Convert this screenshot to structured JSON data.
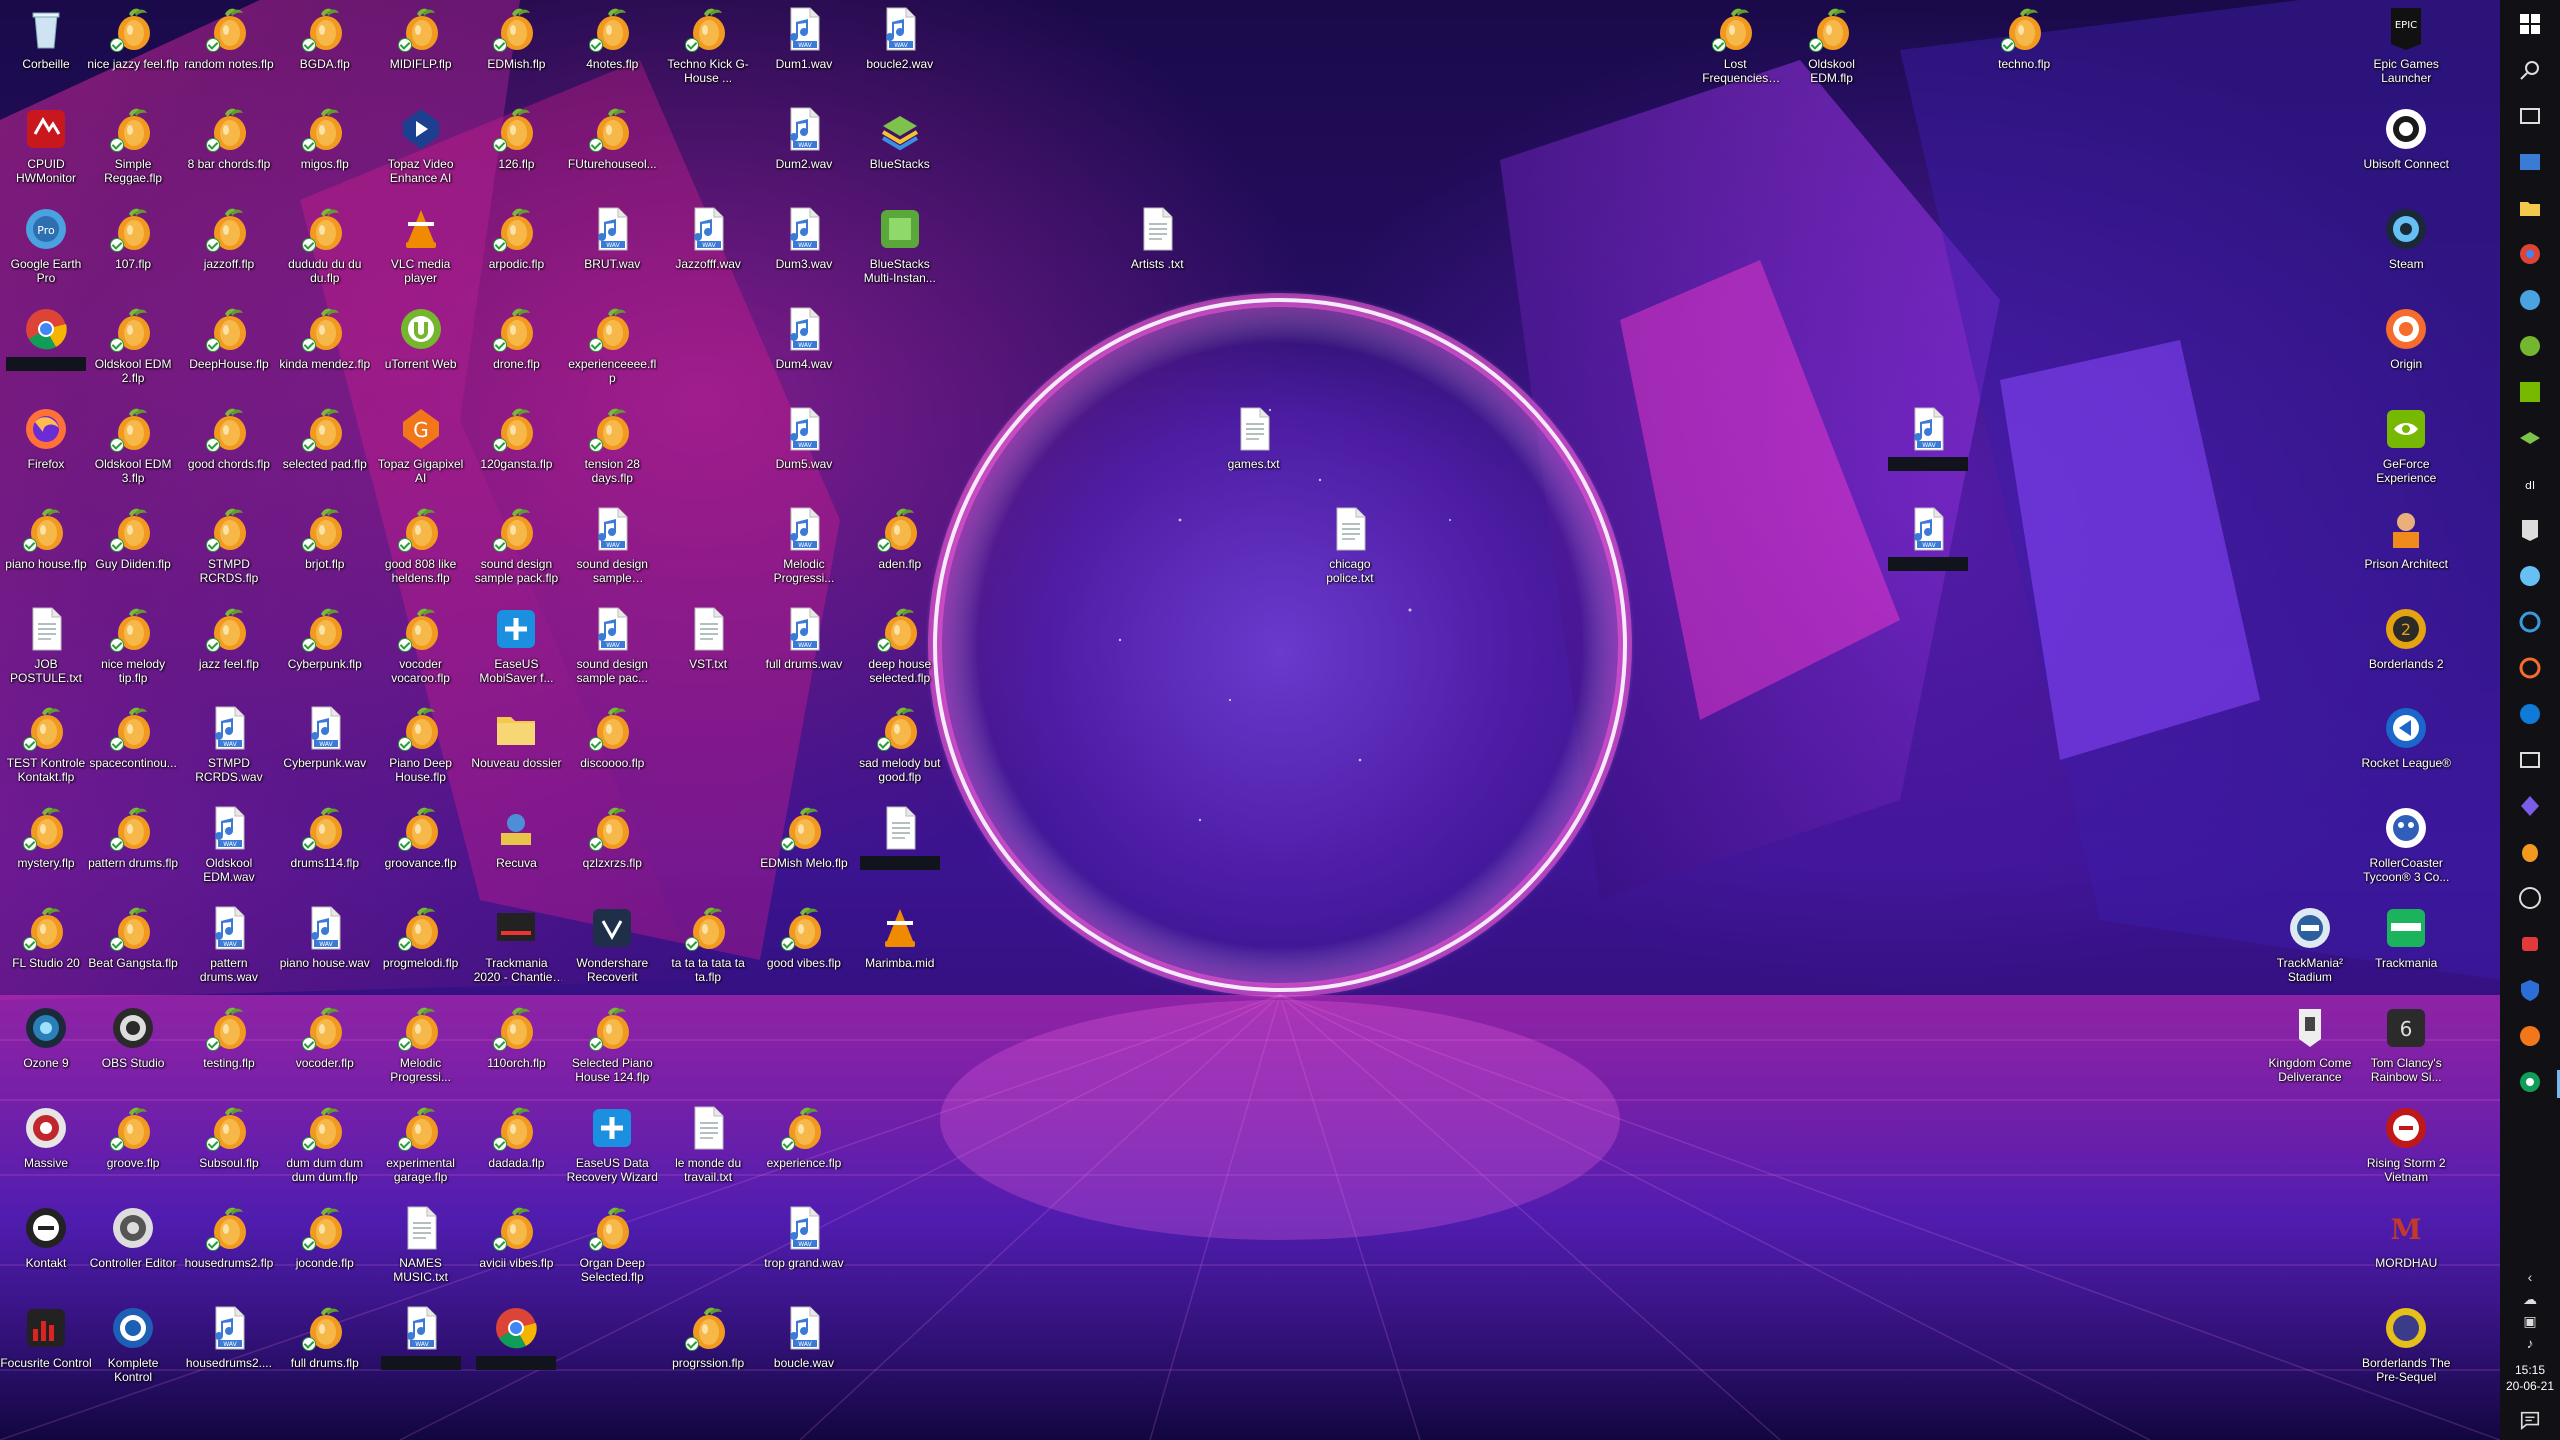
{
  "screen": {
    "width": 2560,
    "height": 1440
  },
  "accent_colors": {
    "fl_orange": "#f29a1f",
    "wav_blue": "#3b7bd6",
    "ring_glow": "#e8d8ff",
    "taskbar": "#101015"
  },
  "desktop_icons": [
    {
      "label": "Corbeille",
      "icon": "recycle-bin",
      "col": 0,
      "row": 0
    },
    {
      "label": "CPUID HWMonitor",
      "icon": "hwmonitor",
      "col": 0,
      "row": 1
    },
    {
      "label": "Google Earth Pro",
      "icon": "google-earth",
      "col": 0,
      "row": 2
    },
    {
      "label": "",
      "icon": "chrome",
      "col": 0,
      "row": 3,
      "redacted": true
    },
    {
      "label": "Firefox",
      "icon": "firefox",
      "col": 0,
      "row": 4
    },
    {
      "label": "piano house.flp",
      "icon": "fl-project",
      "col": 0,
      "row": 5
    },
    {
      "label": "JOB POSTULE.txt",
      "icon": "text-file",
      "col": 0,
      "row": 6
    },
    {
      "label": "TEST Kontrole Kontakt.flp",
      "icon": "fl-project",
      "col": 0,
      "row": 7
    },
    {
      "label": "mystery.flp",
      "icon": "fl-project",
      "col": 0,
      "row": 8
    },
    {
      "label": "FL Studio 20",
      "icon": "fl-project",
      "col": 0,
      "row": 9
    },
    {
      "label": "Ozone 9",
      "icon": "ozone",
      "col": 0,
      "row": 10
    },
    {
      "label": "Massive",
      "icon": "massive",
      "col": 0,
      "row": 11
    },
    {
      "label": "Kontakt",
      "icon": "kontakt",
      "col": 0,
      "row": 12
    },
    {
      "label": "Focusrite Control",
      "icon": "focusrite",
      "col": 0,
      "row": 13
    },
    {
      "label": "nice jazzy feel.flp",
      "icon": "fl-project",
      "col": 1,
      "row": 0
    },
    {
      "label": "Simple Reggae.flp",
      "icon": "fl-project",
      "col": 1,
      "row": 1
    },
    {
      "label": "107.flp",
      "icon": "fl-project",
      "col": 1,
      "row": 2
    },
    {
      "label": "Oldskool EDM 2.flp",
      "icon": "fl-project",
      "col": 1,
      "row": 3
    },
    {
      "label": "Oldskool EDM 3.flp",
      "icon": "fl-project",
      "col": 1,
      "row": 4
    },
    {
      "label": "Guy Diiden.flp",
      "icon": "fl-project",
      "col": 1,
      "row": 5
    },
    {
      "label": "nice melody tip.flp",
      "icon": "fl-project",
      "col": 1,
      "row": 6
    },
    {
      "label": "spacecontinou...",
      "icon": "fl-project",
      "col": 1,
      "row": 7
    },
    {
      "label": "pattern drums.flp",
      "icon": "fl-project",
      "col": 1,
      "row": 8
    },
    {
      "label": "Beat Gangsta.flp",
      "icon": "fl-project",
      "col": 1,
      "row": 9
    },
    {
      "label": "OBS Studio",
      "icon": "obs",
      "col": 1,
      "row": 10
    },
    {
      "label": "groove.flp",
      "icon": "fl-project",
      "col": 1,
      "row": 11
    },
    {
      "label": "Controller Editor",
      "icon": "controller-editor",
      "col": 1,
      "row": 12
    },
    {
      "label": "Komplete Kontrol",
      "icon": "komplete",
      "col": 1,
      "row": 13
    },
    {
      "label": "random notes.flp",
      "icon": "fl-project",
      "col": 2,
      "row": 0
    },
    {
      "label": "8 bar chords.flp",
      "icon": "fl-project",
      "col": 2,
      "row": 1
    },
    {
      "label": "jazzoff.flp",
      "icon": "fl-project",
      "col": 2,
      "row": 2
    },
    {
      "label": "DeepHouse.flp",
      "icon": "fl-project",
      "col": 2,
      "row": 3
    },
    {
      "label": "good chords.flp",
      "icon": "fl-project",
      "col": 2,
      "row": 4
    },
    {
      "label": "STMPD RCRDS.flp",
      "icon": "fl-project",
      "col": 2,
      "row": 5
    },
    {
      "label": "jazz feel.flp",
      "icon": "fl-project",
      "col": 2,
      "row": 6
    },
    {
      "label": "STMPD RCRDS.wav",
      "icon": "wav-file",
      "col": 2,
      "row": 7
    },
    {
      "label": "Oldskool EDM.wav",
      "icon": "wav-file",
      "col": 2,
      "row": 8
    },
    {
      "label": "pattern drums.wav",
      "icon": "wav-file",
      "col": 2,
      "row": 9
    },
    {
      "label": "testing.flp",
      "icon": "fl-project",
      "col": 2,
      "row": 10
    },
    {
      "label": "Subsoul.flp",
      "icon": "fl-project",
      "col": 2,
      "row": 11
    },
    {
      "label": "housedrums2.flp",
      "icon": "fl-project",
      "col": 2,
      "row": 12
    },
    {
      "label": "housedrums2....",
      "icon": "wav-file",
      "col": 2,
      "row": 13
    },
    {
      "label": "BGDA.flp",
      "icon": "fl-project",
      "col": 3,
      "row": 0
    },
    {
      "label": "migos.flp",
      "icon": "fl-project",
      "col": 3,
      "row": 1
    },
    {
      "label": "dududu du du du.flp",
      "icon": "fl-project",
      "col": 3,
      "row": 2
    },
    {
      "label": "kinda mendez.flp",
      "icon": "fl-project",
      "col": 3,
      "row": 3
    },
    {
      "label": "selected pad.flp",
      "icon": "fl-project",
      "col": 3,
      "row": 4
    },
    {
      "label": "brjot.flp",
      "icon": "fl-project",
      "col": 3,
      "row": 5
    },
    {
      "label": "Cyberpunk.flp",
      "icon": "fl-project",
      "col": 3,
      "row": 6
    },
    {
      "label": "Cyberpunk.wav",
      "icon": "wav-file",
      "col": 3,
      "row": 7
    },
    {
      "label": "drums114.flp",
      "icon": "fl-project",
      "col": 3,
      "row": 8
    },
    {
      "label": "piano house.wav",
      "icon": "wav-file",
      "col": 3,
      "row": 9
    },
    {
      "label": "vocoder.flp",
      "icon": "fl-project",
      "col": 3,
      "row": 10
    },
    {
      "label": "dum dum dum dum dum.flp",
      "icon": "fl-project",
      "col": 3,
      "row": 11
    },
    {
      "label": "joconde.flp",
      "icon": "fl-project",
      "col": 3,
      "row": 12
    },
    {
      "label": "full drums.flp",
      "icon": "fl-project",
      "col": 3,
      "row": 13
    },
    {
      "label": "MIDIFLP.flp",
      "icon": "fl-project",
      "col": 4,
      "row": 0
    },
    {
      "label": "Topaz Video Enhance AI",
      "icon": "topaz-video",
      "col": 4,
      "row": 1
    },
    {
      "label": "VLC media player",
      "icon": "vlc",
      "col": 4,
      "row": 2
    },
    {
      "label": "uTorrent Web",
      "icon": "utorrent",
      "col": 4,
      "row": 3
    },
    {
      "label": "Topaz Gigapixel AI",
      "icon": "topaz-giga",
      "col": 4,
      "row": 4
    },
    {
      "label": "good 808 like heldens.flp",
      "icon": "fl-project",
      "col": 4,
      "row": 5
    },
    {
      "label": "vocoder vocaroo.flp",
      "icon": "fl-project",
      "col": 4,
      "row": 6
    },
    {
      "label": "Piano Deep House.flp",
      "icon": "fl-project",
      "col": 4,
      "row": 7
    },
    {
      "label": "groovance.flp",
      "icon": "fl-project",
      "col": 4,
      "row": 8
    },
    {
      "label": "progmelodi.flp",
      "icon": "fl-project",
      "col": 4,
      "row": 9
    },
    {
      "label": "Melodic Progressi...",
      "icon": "fl-project",
      "col": 4,
      "row": 10
    },
    {
      "label": "experimental garage.flp",
      "icon": "fl-project",
      "col": 4,
      "row": 11
    },
    {
      "label": "NAMES MUSIC.txt",
      "icon": "text-file",
      "col": 4,
      "row": 12
    },
    {
      "label": "",
      "icon": "wav-file",
      "col": 4,
      "row": 13,
      "redacted": true
    },
    {
      "label": "EDMish.flp",
      "icon": "fl-project",
      "col": 5,
      "row": 0
    },
    {
      "label": "126.flp",
      "icon": "fl-project",
      "col": 5,
      "row": 1
    },
    {
      "label": "arpodic.flp",
      "icon": "fl-project",
      "col": 5,
      "row": 2
    },
    {
      "label": "drone.flp",
      "icon": "fl-project",
      "col": 5,
      "row": 3
    },
    {
      "label": "120gansta.flp",
      "icon": "fl-project",
      "col": 5,
      "row": 4
    },
    {
      "label": "sound design sample pack.flp",
      "icon": "fl-project",
      "col": 5,
      "row": 5
    },
    {
      "label": "EaseUS MobiSaver f...",
      "icon": "easeus",
      "col": 5,
      "row": 6
    },
    {
      "label": "Nouveau dossier",
      "icon": "folder",
      "col": 5,
      "row": 7
    },
    {
      "label": "Recuva",
      "icon": "recuva",
      "col": 5,
      "row": 8
    },
    {
      "label": "Trackmania 2020 - Chantier, 3m...",
      "icon": "trackmania-shot",
      "col": 5,
      "row": 9
    },
    {
      "label": "110orch.flp",
      "icon": "fl-project",
      "col": 5,
      "row": 10
    },
    {
      "label": "dadada.flp",
      "icon": "fl-project",
      "col": 5,
      "row": 11
    },
    {
      "label": "avicii vibes.flp",
      "icon": "fl-project",
      "col": 5,
      "row": 12
    },
    {
      "label": "",
      "icon": "chrome",
      "col": 5,
      "row": 13,
      "redacted": true
    },
    {
      "label": "4notes.flp",
      "icon": "fl-project",
      "col": 6,
      "row": 0
    },
    {
      "label": "FUturehouseol...",
      "icon": "fl-project",
      "col": 6,
      "row": 1
    },
    {
      "label": "BRUT.wav",
      "icon": "wav-file",
      "col": 6,
      "row": 2
    },
    {
      "label": "experienceeee.flp",
      "icon": "fl-project",
      "col": 6,
      "row": 3
    },
    {
      "label": "tension 28 days.flp",
      "icon": "fl-project",
      "col": 6,
      "row": 4
    },
    {
      "label": "sound design sample pack.wav",
      "icon": "wav-file",
      "col": 6,
      "row": 5
    },
    {
      "label": "sound design sample pac...",
      "icon": "wav-file",
      "col": 6,
      "row": 6
    },
    {
      "label": "discoooo.flp",
      "icon": "fl-project",
      "col": 6,
      "row": 7
    },
    {
      "label": "qzlzxrzs.flp",
      "icon": "fl-project",
      "col": 6,
      "row": 8
    },
    {
      "label": "Wondershare Recoverit",
      "icon": "wondershare",
      "col": 6,
      "row": 9
    },
    {
      "label": "Selected Piano House 124.flp",
      "icon": "fl-project",
      "col": 6,
      "row": 10
    },
    {
      "label": "EaseUS Data Recovery Wizard",
      "icon": "easeus",
      "col": 6,
      "row": 11
    },
    {
      "label": "Organ Deep Selected.flp",
      "icon": "fl-project",
      "col": 6,
      "row": 12
    },
    {
      "label": "Techno Kick G-House ...",
      "icon": "fl-project",
      "col": 7,
      "row": 0
    },
    {
      "label": "Jazzofff.wav",
      "icon": "wav-file",
      "col": 7,
      "row": 2
    },
    {
      "label": "VST.txt",
      "icon": "text-file",
      "col": 7,
      "row": 6
    },
    {
      "label": "ta ta ta tata ta ta.flp",
      "icon": "fl-project",
      "col": 7,
      "row": 9
    },
    {
      "label": "le monde du travail.txt",
      "icon": "text-file",
      "col": 7,
      "row": 11
    },
    {
      "label": "progrssion.flp",
      "icon": "fl-project",
      "col": 7,
      "row": 13
    },
    {
      "label": "Dum1.wav",
      "icon": "wav-file",
      "col": 8,
      "row": 0
    },
    {
      "label": "Dum2.wav",
      "icon": "wav-file",
      "col": 8,
      "row": 1
    },
    {
      "label": "Dum3.wav",
      "icon": "wav-file",
      "col": 8,
      "row": 2
    },
    {
      "label": "Dum4.wav",
      "icon": "wav-file",
      "col": 8,
      "row": 3
    },
    {
      "label": "Dum5.wav",
      "icon": "wav-file",
      "col": 8,
      "row": 4
    },
    {
      "label": "Melodic Progressi...",
      "icon": "wav-file",
      "col": 8,
      "row": 5
    },
    {
      "label": "full drums.wav",
      "icon": "wav-file",
      "col": 8,
      "row": 6
    },
    {
      "label": "EDMish Melo.flp",
      "icon": "fl-project",
      "col": 8,
      "row": 8
    },
    {
      "label": "good vibes.flp",
      "icon": "fl-project",
      "col": 8,
      "row": 9
    },
    {
      "label": "experience.flp",
      "icon": "fl-project",
      "col": 8,
      "row": 11
    },
    {
      "label": "trop grand.wav",
      "icon": "wav-file",
      "col": 8,
      "row": 12
    },
    {
      "label": "boucle.wav",
      "icon": "wav-file",
      "col": 8,
      "row": 13
    },
    {
      "label": "boucle2.wav",
      "icon": "wav-file",
      "col": 9,
      "row": 0
    },
    {
      "label": "BlueStacks",
      "icon": "bluestacks",
      "col": 9,
      "row": 1
    },
    {
      "label": "BlueStacks Multi-Instan...",
      "icon": "bluestacks-multi",
      "col": 9,
      "row": 2
    },
    {
      "label": "aden.flp",
      "icon": "fl-project",
      "col": 9,
      "row": 5
    },
    {
      "label": "deep house selected.flp",
      "icon": "fl-project",
      "col": 9,
      "row": 6
    },
    {
      "label": "sad melody but good.flp",
      "icon": "fl-project",
      "col": 9,
      "row": 7
    },
    {
      "label": "",
      "icon": "text-file",
      "col": 9,
      "row": 8,
      "redacted": true
    },
    {
      "label": "Marimba.mid",
      "icon": "vlc",
      "col": 9,
      "row": 9
    },
    {
      "label": "Artists .txt",
      "icon": "text-file",
      "col": 12,
      "row": 2
    },
    {
      "label": "games.txt",
      "icon": "text-file",
      "col": 13,
      "row": 4
    },
    {
      "label": "chicago police.txt",
      "icon": "text-file",
      "col": 14,
      "row": 5
    },
    {
      "label": "Lost Frequencies Morten.flp",
      "icon": "fl-project",
      "col": 18,
      "row": 0
    },
    {
      "label": "Oldskool EDM.flp",
      "icon": "fl-project",
      "col": 19,
      "row": 0
    },
    {
      "label": "",
      "icon": "wav-file",
      "col": 20,
      "row": 4,
      "redacted": true
    },
    {
      "label": "",
      "icon": "wav-file",
      "col": 20,
      "row": 5,
      "redacted": true
    },
    {
      "label": "techno.flp",
      "icon": "fl-project",
      "col": 21,
      "row": 0
    },
    {
      "label": "TrackMania² Stadium",
      "icon": "trackmania2",
      "col": 24,
      "row": 9
    },
    {
      "label": "Kingdom Come Deliverance",
      "icon": "kingdom-come",
      "col": 24,
      "row": 10
    },
    {
      "label": "Epic Games Launcher",
      "icon": "epic-games",
      "col": 25,
      "row": 0
    },
    {
      "label": "Ubisoft Connect",
      "icon": "ubisoft",
      "col": 25,
      "row": 1
    },
    {
      "label": "Steam",
      "icon": "steam",
      "col": 25,
      "row": 2
    },
    {
      "label": "Origin",
      "icon": "origin",
      "col": 25,
      "row": 3
    },
    {
      "label": "GeForce Experience",
      "icon": "nvidia",
      "col": 25,
      "row": 4
    },
    {
      "label": "Prison Architect",
      "icon": "prison-architect",
      "col": 25,
      "row": 5
    },
    {
      "label": "Borderlands 2",
      "icon": "borderlands",
      "col": 25,
      "row": 6
    },
    {
      "label": "Rocket League®",
      "icon": "rocket-league",
      "col": 25,
      "row": 7
    },
    {
      "label": "RollerCoaster Tycoon® 3 Co...",
      "icon": "rct3",
      "col": 25,
      "row": 8
    },
    {
      "label": "Trackmania",
      "icon": "trackmania",
      "col": 25,
      "row": 9
    },
    {
      "label": "Tom Clancy's Rainbow Si...",
      "icon": "rainbow-six",
      "col": 25,
      "row": 10
    },
    {
      "label": "Rising Storm 2 Vietnam",
      "icon": "rising-storm",
      "col": 25,
      "row": 11
    },
    {
      "label": "MORDHAU",
      "icon": "mordhau",
      "col": 25,
      "row": 12
    },
    {
      "label": "Borderlands The Pre-Sequel",
      "icon": "borderlands-tps",
      "col": 25,
      "row": 13
    }
  ],
  "taskbar": {
    "pinned": [
      {
        "icon": "windows-start-icon"
      },
      {
        "icon": "search-icon"
      },
      {
        "icon": "task-view-icon"
      },
      {
        "icon": "photos-icon"
      },
      {
        "icon": "explorer-icon"
      },
      {
        "icon": "chrome-icon"
      },
      {
        "icon": "earth-icon"
      },
      {
        "icon": "utorrent-icon"
      },
      {
        "icon": "nvidia-icon"
      },
      {
        "icon": "bluestacks-icon"
      },
      {
        "icon": "dl-icon"
      },
      {
        "icon": "epic-icon"
      },
      {
        "icon": "steam-icon"
      },
      {
        "icon": "ubisoft-icon"
      },
      {
        "icon": "origin-icon"
      },
      {
        "icon": "edge-icon"
      },
      {
        "icon": "film-icon"
      },
      {
        "icon": "diamond-icon"
      },
      {
        "icon": "fl-icon"
      },
      {
        "icon": "obs-icon"
      },
      {
        "icon": "red-app-icon"
      },
      {
        "icon": "shield-icon"
      },
      {
        "icon": "topaz-icon"
      },
      {
        "icon": "chrome2-icon"
      }
    ],
    "tray_icons": [
      "chevron-up-icon",
      "onedrive-icon",
      "network-icon",
      "volume-icon"
    ],
    "clock_time": "15:15",
    "clock_date": "20-06-21"
  }
}
